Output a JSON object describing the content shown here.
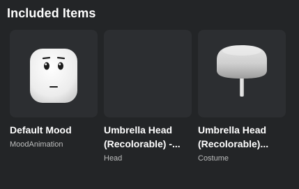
{
  "section": {
    "title": "Included Items"
  },
  "items": [
    {
      "name": "Default Mood",
      "type": "MoodAnimation",
      "thumbnail_icon": "smiley-head-icon"
    },
    {
      "name": "Umbrella Head (Recolorable) -...",
      "type": "Head",
      "thumbnail_icon": "blank-thumbnail"
    },
    {
      "name": "Umbrella Head (Recolorable)...",
      "type": "Costume",
      "thumbnail_icon": "umbrella-head-icon"
    }
  ],
  "colors": {
    "background": "#232527",
    "card": "#2c2e31",
    "text_primary": "#ffffff",
    "text_secondary": "#bdbebe"
  }
}
